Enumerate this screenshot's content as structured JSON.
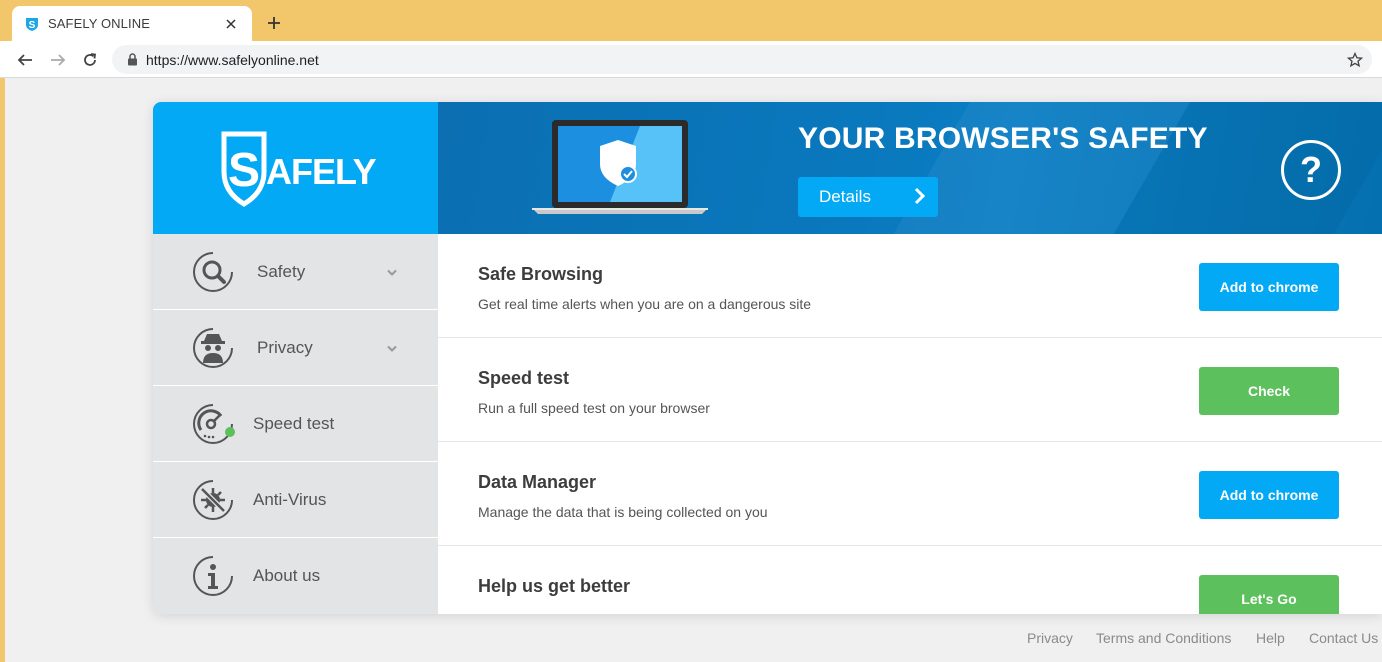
{
  "browser": {
    "tab_title": "SAFELY ONLINE",
    "url": "https://www.safelyonline.net"
  },
  "brand": {
    "logo_text": "SAFELY",
    "primary": "#03a9f4",
    "banner": "#0a78bd",
    "green": "#5cc05c"
  },
  "banner": {
    "title": "YOUR BROWSER'S SAFETY",
    "details_label": "Details",
    "help_label": "?"
  },
  "sidebar": {
    "items": [
      {
        "label": "Safety",
        "icon": "search-icon"
      },
      {
        "label": "Privacy",
        "icon": "spy-icon"
      },
      {
        "label": "Speed test",
        "icon": "speedometer-icon"
      },
      {
        "label": "Anti-Virus",
        "icon": "no-virus-icon"
      },
      {
        "label": "About us",
        "icon": "info-icon"
      }
    ]
  },
  "features": [
    {
      "title": "Safe Browsing",
      "desc": "Get real time alerts when you are on a dangerous site",
      "button": "Add to chrome",
      "color": "#03a9f4"
    },
    {
      "title": "Speed test",
      "desc": "Run a full speed test on your browser",
      "button": "Check",
      "color": "#5cc05c"
    },
    {
      "title": "Data Manager",
      "desc": "Manage the data that is being collected on you",
      "button": "Add to chrome",
      "color": "#03a9f4"
    },
    {
      "title": "Help us get better",
      "desc": "",
      "button": "Let's Go",
      "color": "#5cc05c"
    }
  ],
  "footer": {
    "links": [
      "Privacy",
      "Terms and Conditions",
      "Help",
      "Contact Us"
    ]
  }
}
